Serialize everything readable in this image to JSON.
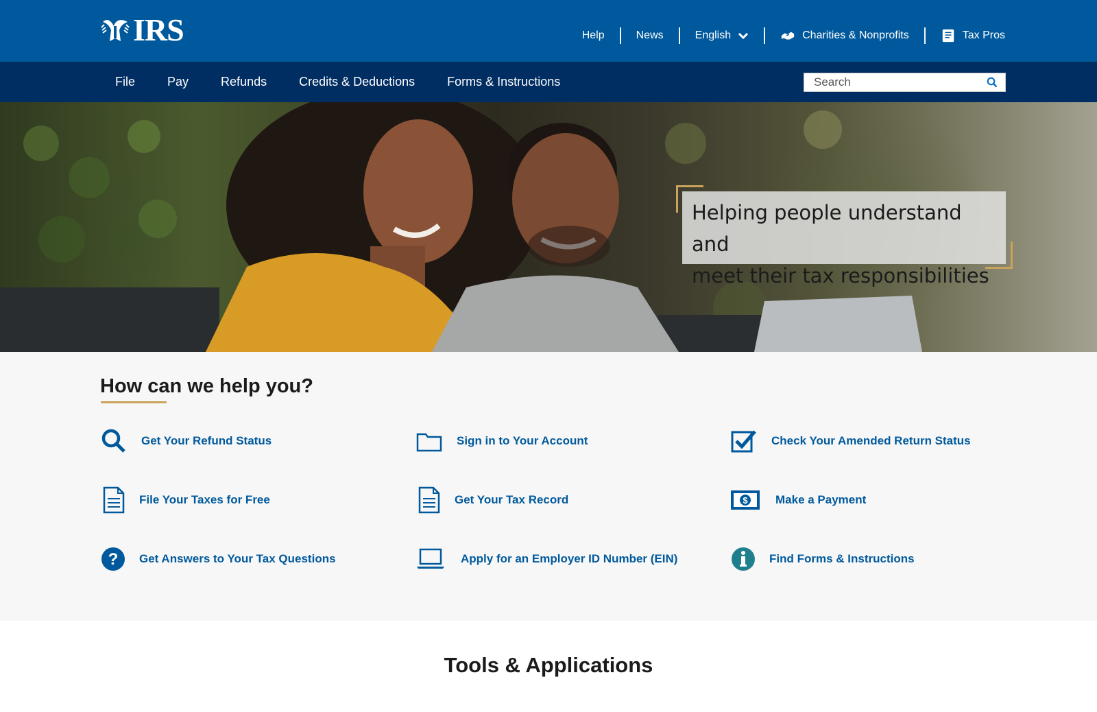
{
  "header": {
    "logo_text": "IRS",
    "utility_nav": [
      {
        "label": "Help"
      },
      {
        "label": "News"
      },
      {
        "label": "English"
      },
      {
        "label": "Charities & Nonprofits"
      },
      {
        "label": "Tax Pros"
      }
    ]
  },
  "main_nav": {
    "items": [
      {
        "label": "File"
      },
      {
        "label": "Pay"
      },
      {
        "label": "Refunds"
      },
      {
        "label": "Credits & Deductions"
      },
      {
        "label": "Forms & Instructions"
      }
    ],
    "search_placeholder": "Search"
  },
  "hero": {
    "line1": "Helping people understand and",
    "line2": "meet their tax responsibilities"
  },
  "help": {
    "title": "How can we help you?",
    "links": [
      {
        "label": "Get Your Refund Status",
        "icon": "search-icon"
      },
      {
        "label": "Sign in to Your Account",
        "icon": "folder-icon"
      },
      {
        "label": "Check Your Amended Return Status",
        "icon": "checkbox-icon"
      },
      {
        "label": "File Your Taxes for Free",
        "icon": "document-icon"
      },
      {
        "label": "Get Your Tax Record",
        "icon": "document-icon"
      },
      {
        "label": "Make a Payment",
        "icon": "dollar-bill-icon"
      },
      {
        "label": "Get Answers to Your Tax Questions",
        "icon": "question-circle-icon"
      },
      {
        "label": "Apply for an Employer ID Number (EIN)",
        "icon": "laptop-icon"
      },
      {
        "label": "Find Forms & Instructions",
        "icon": "info-circle-icon"
      }
    ]
  },
  "tools": {
    "title": "Tools & Applications"
  },
  "colors": {
    "brand_blue": "#00599c",
    "nav_navy": "#002d62",
    "accent_gold": "#c9a45a",
    "info_teal": "#1f7f8c"
  }
}
